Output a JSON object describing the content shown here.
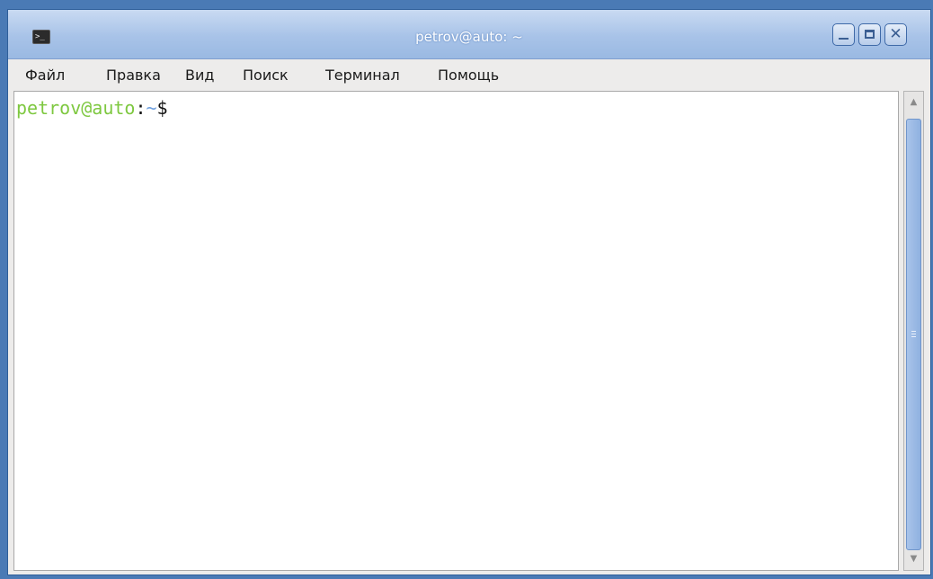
{
  "window": {
    "title": "petrov@auto: ~",
    "icon": "terminal-icon",
    "controls": {
      "minimize": "minimize-icon",
      "maximize": "maximize-icon",
      "close": "close-icon"
    }
  },
  "menu": {
    "items": [
      "Файл",
      "Правка",
      "Вид",
      "Поиск",
      "Терминал",
      "Помощь"
    ]
  },
  "terminal": {
    "user_host": "petrov@auto",
    "colon": ":",
    "path": "~",
    "symbol": "$",
    "colors": {
      "user_host": "#7ec840",
      "path": "#6fa0df",
      "text": "#111111",
      "background": "#ffffff"
    }
  },
  "scrollbar": {
    "thumb_color": "#9bb9e4",
    "up_arrow": "▲",
    "down_arrow": "▼"
  }
}
